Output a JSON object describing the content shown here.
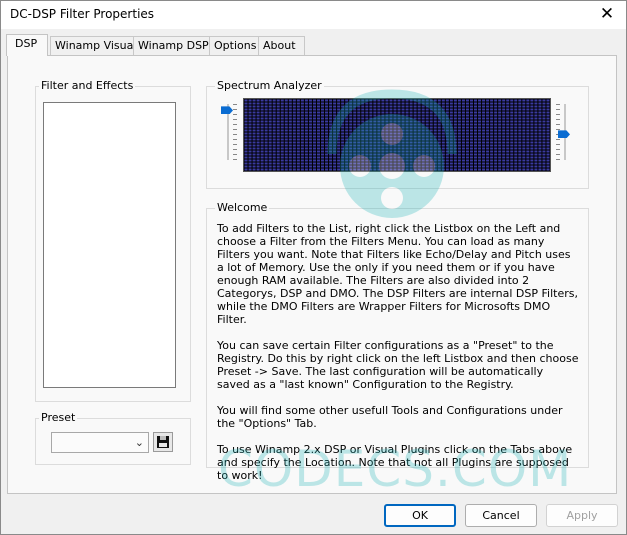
{
  "window": {
    "title": "DC-DSP Filter Properties",
    "close_glyph": "✕"
  },
  "tabs": [
    {
      "label": "DSP",
      "active": true
    },
    {
      "label": "Winamp Visual",
      "active": false
    },
    {
      "label": "Winamp DSP",
      "active": false
    },
    {
      "label": "Options",
      "active": false
    },
    {
      "label": "About",
      "active": false
    }
  ],
  "groups": {
    "filters_label": "Filter and Effects",
    "preset_label": "Preset",
    "spectrum_label": "Spectrum Analyzer",
    "welcome_label": "Welcome"
  },
  "preset": {
    "value": "",
    "icon": "floppy-disk-icon"
  },
  "spectrum": {
    "bar_color": "#3a3aa0",
    "background": "#000000",
    "left_slider_level": 0.05,
    "right_slider_level": 0.55
  },
  "welcome": {
    "paragraphs": [
      "To add Filters to the List, right click the Listbox on the Left and choose a Filter from the Filters Menu. You can load as many Filters you want. Note that Filters like Echo/Delay and Pitch uses a lot of Memory. Use the only if you need them or if you have enough RAM available. The Filters are also divided into 2 Categorys, DSP and DMO. The DSP Filters are internal DSP Filters, while the DMO Filters are Wrapper Filters for Microsofts DMO Filter.",
      "You can save certain Filter configurations as a \"Preset\" to the Registry. Do this by right click on the left Listbox and then choose Preset -> Save. The last configuration will be automatically saved as a \"last known\" Configuration to the Registry.",
      "You will find some other usefull Tools and Configurations under the \"Options\" Tab.",
      "To use Winamp 2.x DSP or Visual Plugins click on the Tabs above and specify  the Location. Note that not all Plugins are supposed to work!"
    ]
  },
  "buttons": {
    "ok": "OK",
    "cancel": "Cancel",
    "apply": "Apply"
  },
  "watermark": {
    "text": "CODECS.COM",
    "color": "#1fb3b7"
  }
}
